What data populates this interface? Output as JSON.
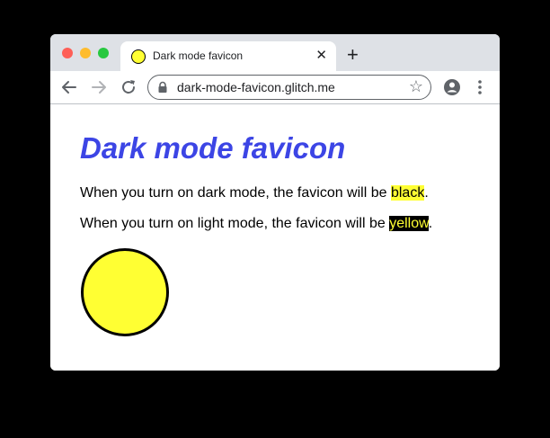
{
  "browser": {
    "tab": {
      "title": "Dark mode favicon",
      "favicon": "yellow-circle-icon",
      "close_glyph": "✕"
    },
    "new_tab_glyph": "+",
    "address_bar": {
      "url": "dark-mode-favicon.glitch.me",
      "icons": [
        "lock-icon",
        "star-icon"
      ]
    },
    "toolbar_icons": [
      "back-arrow-icon",
      "forward-arrow-icon",
      "reload-icon",
      "account-icon",
      "more-menu-icon"
    ]
  },
  "page": {
    "heading": "Dark mode favicon",
    "paragraph1": {
      "before": "When you turn on dark mode, the favicon will be ",
      "highlight": "black",
      "after": "."
    },
    "paragraph2": {
      "before": "When you turn on light mode, the favicon will be ",
      "highlight": "yellow",
      "after": "."
    }
  },
  "colors": {
    "heading": "#3c45e5",
    "yellow": "#ffff33",
    "black": "#000000",
    "window_chrome": "#dee1e6"
  }
}
